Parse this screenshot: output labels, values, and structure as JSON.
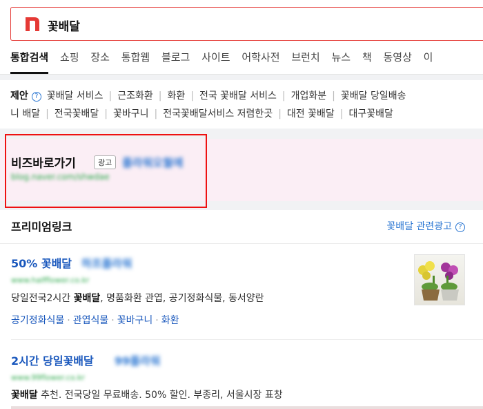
{
  "search": {
    "query": "꽃배달"
  },
  "tabs": [
    {
      "label": "통합검색",
      "active": true
    },
    {
      "label": "쇼핑"
    },
    {
      "label": "장소"
    },
    {
      "label": "통합웹"
    },
    {
      "label": "블로그"
    },
    {
      "label": "사이트"
    },
    {
      "label": "어학사전"
    },
    {
      "label": "브런치"
    },
    {
      "label": "뉴스"
    },
    {
      "label": "책"
    },
    {
      "label": "동영상"
    },
    {
      "label": "이"
    }
  ],
  "suggest": {
    "label": "제안",
    "row1": [
      "꽃배달 서비스",
      "근조화환",
      "화환",
      "전국 꽃배달 서비스",
      "개업화분",
      "꽃배달 당일배송"
    ],
    "row2": [
      "니 배달",
      "전국꽃배달",
      "꽃바구니",
      "전국꽃배달서비스 저렴한곳",
      "대전 꽃배달",
      "대구꽃배달"
    ]
  },
  "biz": {
    "title": "비즈바로가기",
    "ad_badge": "광고",
    "blurred_name": "플라워오월에",
    "blurred_url": "blog.naver.com/shwdae"
  },
  "premium": {
    "heading": "프리미엄링크",
    "related": "꽃배달 관련광고",
    "ad1": {
      "title": "50% 꽃배달",
      "blurred_name": "하프플라워",
      "blurred_url": "www.halfflower.co.kr",
      "desc_prefix": "당일전국2시간 ",
      "desc_bold": "꽃배달",
      "desc_suffix": ", 명품화환 관엽, 공기정화식물, 동서양란",
      "links": [
        "공기정화식물",
        "관엽식물",
        "꽃바구니",
        "화환"
      ]
    },
    "ad2": {
      "title": "2시간 당일꽃배달",
      "blurred_name": "99플라워",
      "blurred_url": "www.99flower.co.kr",
      "desc_bold": "꽃배달",
      "desc_suffix": " 추천. 전국당일 무료배송. 50% 할인. 부종리, 서울시장 표창"
    }
  },
  "colors": {
    "brand": "#03c75a",
    "logo_red": "#e53935",
    "link_blue": "#1a58bd",
    "highlight_red": "#e11111",
    "biz_bg": "#fbeef5"
  },
  "icons": {
    "logo": "naver-n-logo",
    "help": "question-circle-icon"
  }
}
